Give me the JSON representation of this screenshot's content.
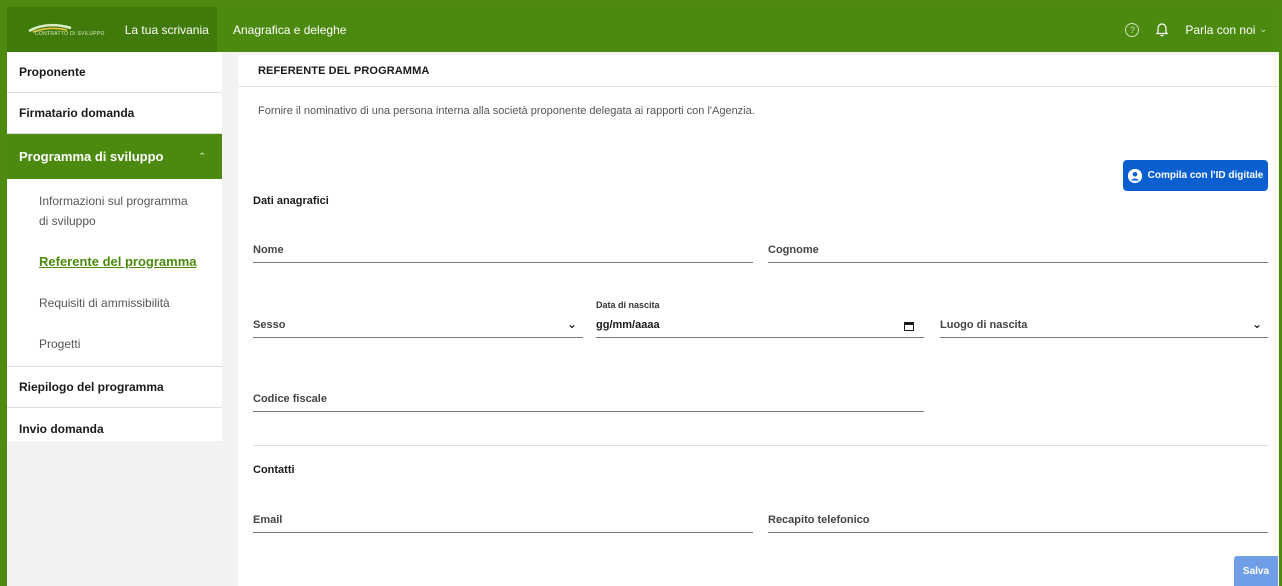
{
  "header": {
    "logo_text": "CONTRATTO DI SVILUPPO",
    "nav": [
      "La tua scrivania",
      "Anagrafica e deleghe"
    ],
    "help_symbol": "?",
    "talk_label": "Parla con noi",
    "brand_color": "#4b8a0f"
  },
  "sidebar": {
    "items": [
      {
        "label": "Proponente"
      },
      {
        "label": "Firmatario domanda"
      },
      {
        "label": "Programma di sviluppo"
      },
      {
        "label": "Riepilogo del programma"
      },
      {
        "label": "Invio domanda"
      }
    ],
    "subitems": [
      {
        "label": "Informazioni sul programma di sviluppo"
      },
      {
        "label": "Referente del programma"
      },
      {
        "label": "Requisiti di ammissibilità"
      },
      {
        "label": "Progetti"
      }
    ]
  },
  "main": {
    "title": "REFERENTE DEL PROGRAMMA",
    "intro": "Fornire il nominativo di una persona interna alla società proponente delegata ai rapporti con l'Agenzia.",
    "id_button_label": "Compila con l'ID digitale",
    "id_button_color": "#0a5fd0",
    "personal_group": "Dati anagrafici",
    "fields": {
      "nome": "Nome",
      "cognome": "Cognome",
      "sesso": "Sesso",
      "data_caption": "Data di nascita",
      "data_value": "gg/mm/aaaa",
      "luogo": "Luogo di nascita",
      "codice_fiscale": "Codice fiscale",
      "email": "Email",
      "telefono": "Recapito telefonico"
    },
    "contacts_group": "Contatti",
    "save_label": "Salva"
  }
}
